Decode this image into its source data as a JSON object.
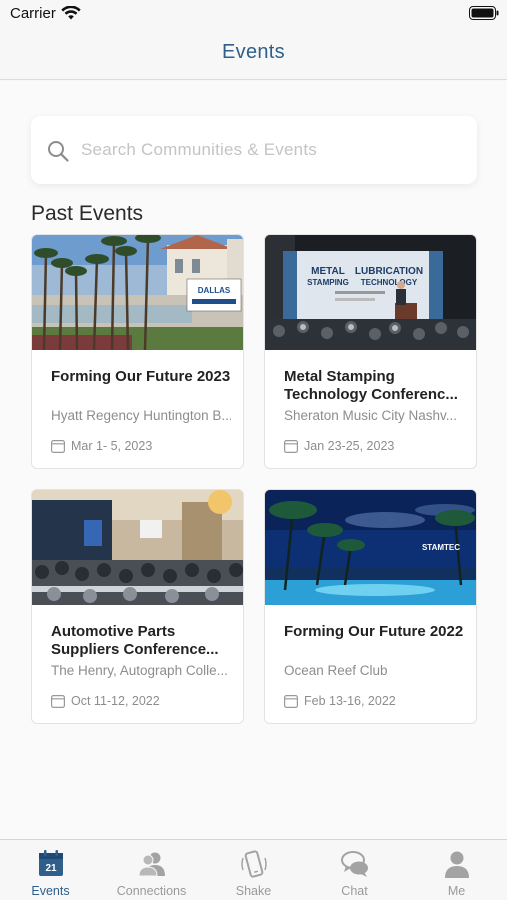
{
  "status_bar": {
    "carrier": "Carrier"
  },
  "nav": {
    "title": "Events"
  },
  "search": {
    "placeholder": "Search Communities & Events"
  },
  "section": {
    "title": "Past Events"
  },
  "events": [
    {
      "title": "Forming Our Future 2023",
      "venue": "Hyatt Regency Huntington B...",
      "dates": "Mar  1- 5, 2023",
      "image": "resort-fountain-palms-photo"
    },
    {
      "title": "Metal Stamping Technology Conferenc...",
      "venue": "Sheraton Music City Nashv...",
      "dates": "Jan 23-25, 2023",
      "image": "conference-stage-photo"
    },
    {
      "title": "Automotive Parts Suppliers Conference...",
      "venue": "The Henry, Autograph Colle...",
      "dates": "Oct 11-12, 2022",
      "image": "ballroom-audience-photo"
    },
    {
      "title": "Forming Our Future 2022",
      "venue": "Ocean Reef Club",
      "dates": "Feb 13-16, 2022",
      "image": "night-pool-palms-photo"
    }
  ],
  "image_text": {
    "dallas_logo": "DALLAS",
    "banner_metal": "METAL",
    "banner_stamping": "STAMPING",
    "banner_lubrication": "LUBRICATION",
    "banner_technology": "TECHNOLOGY",
    "stamtec_logo": "STAMTEC"
  },
  "calendar_badge": "21",
  "tabs": [
    {
      "label": "Events",
      "icon": "calendar-icon",
      "active": true
    },
    {
      "label": "Connections",
      "icon": "people-icon",
      "active": false
    },
    {
      "label": "Shake",
      "icon": "phone-shake-icon",
      "active": false
    },
    {
      "label": "Chat",
      "icon": "chat-bubbles-icon",
      "active": false
    },
    {
      "label": "Me",
      "icon": "person-icon",
      "active": false
    }
  ],
  "colors": {
    "accent": "#2f5f8a",
    "inactive": "#9a9a9a",
    "background": "#fafafa"
  }
}
